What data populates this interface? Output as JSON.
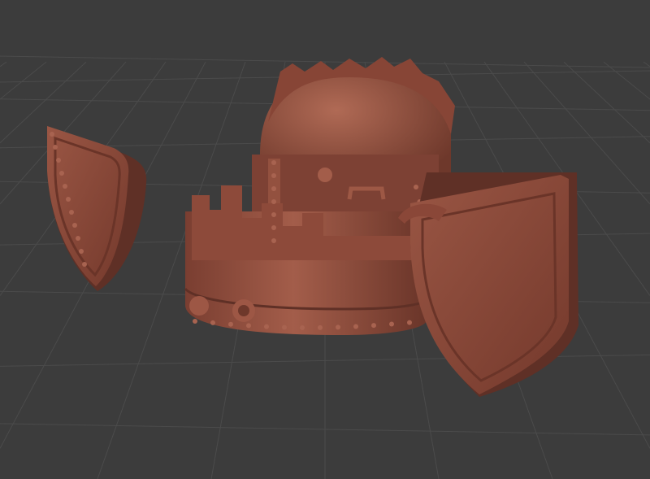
{
  "scene": {
    "background_color": "#3c3c3c",
    "grid_color": "#4b4b4b",
    "model_color": "#8b4a3b",
    "model_shadow_color": "#5f3026",
    "model_highlight_color": "#a8634f"
  }
}
